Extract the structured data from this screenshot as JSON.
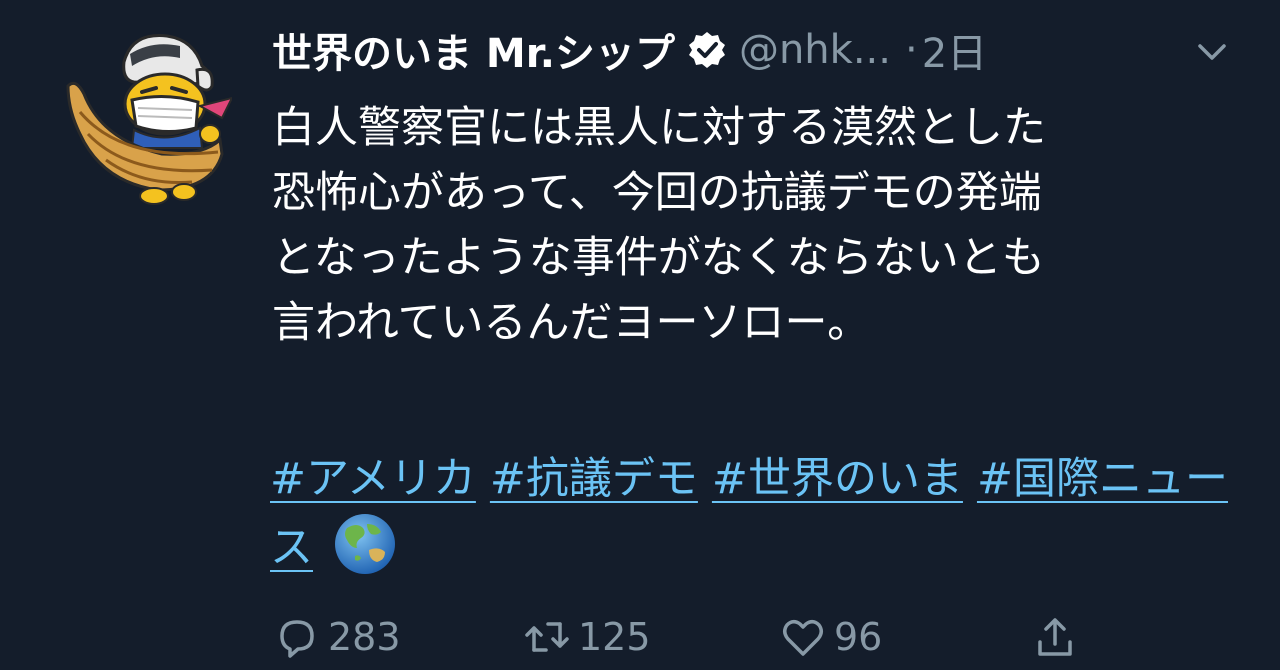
{
  "tweet": {
    "display_name": "世界のいま Mr.シップ",
    "handle": "@nhk...",
    "separator": "·",
    "time": "2日",
    "body": "白人警察官には黒人に対する漠然とした\n恐怖心があって、今回の抗議デモの発端\nとなったような事件がなくならないとも\n言われているんだヨーソロー。",
    "hashtags": [
      "#アメリカ",
      "#抗議デモ",
      "#世界のいま",
      "#国際ニュース"
    ],
    "emoji": "globe-asia-australia"
  },
  "actions": {
    "reply_count": "283",
    "retweet_count": "125",
    "like_count": "96"
  },
  "colors": {
    "background": "#141d2b",
    "text": "#ffffff",
    "muted": "#8899a6",
    "link": "#6bc3f5"
  },
  "icons": {
    "verified": "verified-badge-icon",
    "caret": "chevron-down-icon",
    "reply": "reply-icon",
    "retweet": "retweet-icon",
    "like": "heart-icon",
    "share": "share-icon"
  }
}
